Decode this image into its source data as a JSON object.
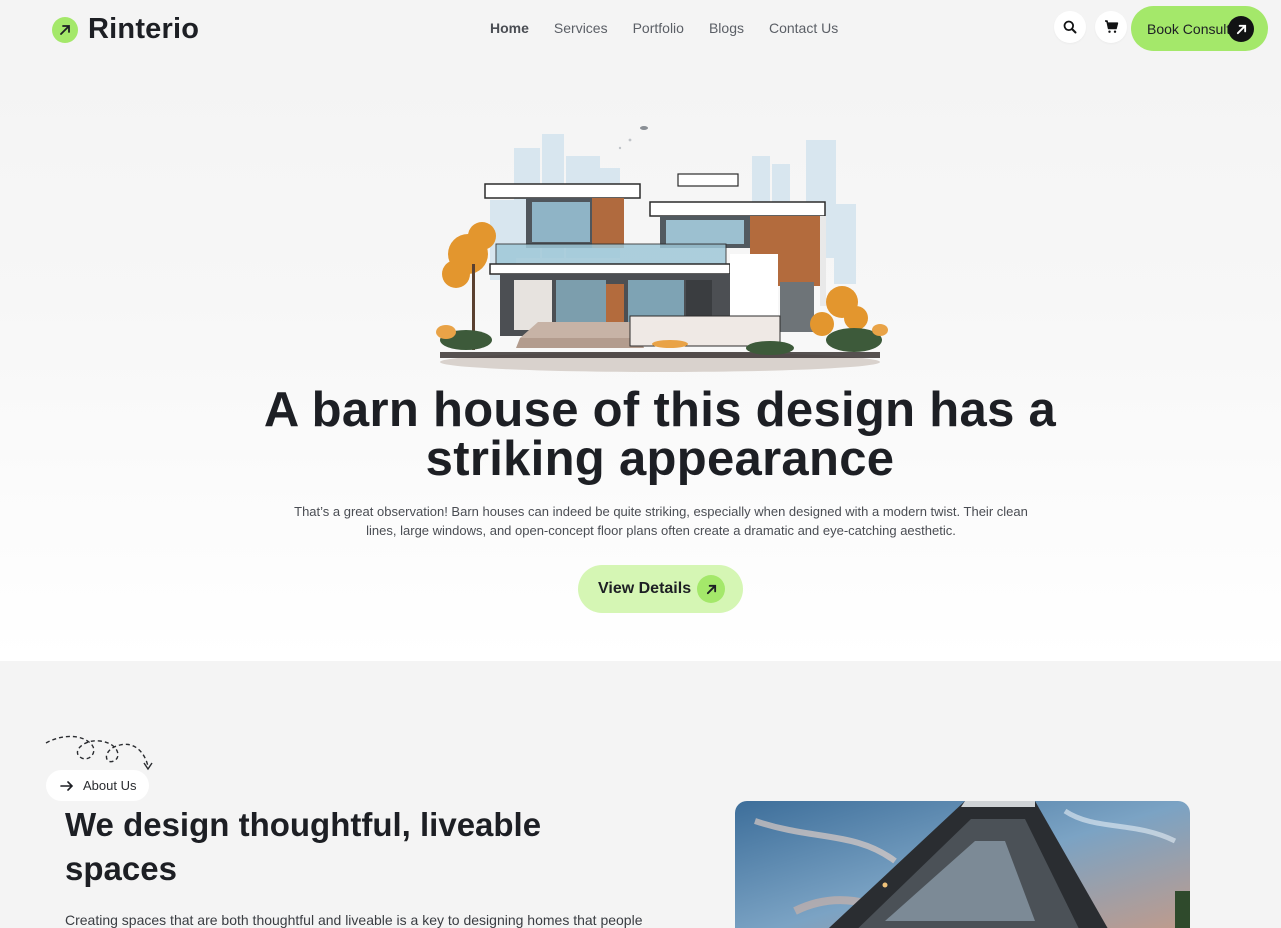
{
  "brand": {
    "name": "Rinterio",
    "accent": "#a4e86a",
    "accent_light": "#d5f6b4"
  },
  "nav": {
    "items": [
      {
        "label": "Home",
        "active": true
      },
      {
        "label": "Services",
        "active": false
      },
      {
        "label": "Portfolio",
        "active": false
      },
      {
        "label": "Blogs",
        "active": false
      },
      {
        "label": "Contact Us",
        "active": false
      }
    ]
  },
  "header": {
    "search_icon": "search-icon",
    "cart_icon": "cart-icon",
    "cta_label": "Book Consult"
  },
  "hero": {
    "title": "A barn house of this design has a striking appearance",
    "description": "That’s a great observation! Barn houses can indeed be quite striking, especially when designed with a modern twist. Their clean lines, large windows, and open-concept floor plans often create a dramatic and eye-catching aesthetic.",
    "cta_label": "View Details"
  },
  "about": {
    "badge_label": "About Us",
    "title": "We design thoughtful, liveable spaces",
    "text": "Creating spaces that are both thoughtful and liveable is a key to designing homes that people"
  }
}
